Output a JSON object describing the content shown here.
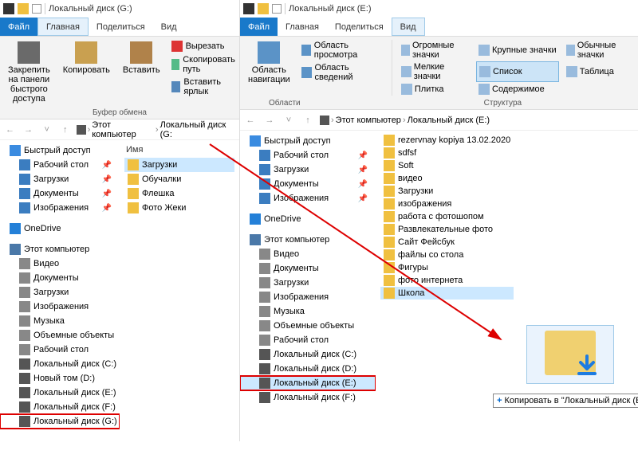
{
  "w1": {
    "title": "Локальный диск (G:)",
    "menu": {
      "file": "Файл",
      "home": "Главная",
      "share": "Поделиться",
      "view": "Вид"
    },
    "ribbon": {
      "pin": "Закрепить на панели быстрого доступа",
      "copy": "Копировать",
      "paste": "Вставить",
      "cut": "Вырезать",
      "copypath": "Скопировать путь",
      "shortcut": "Вставить ярлык",
      "group": "Буфер обмена"
    },
    "crumbs": {
      "pc": "Этот компьютер",
      "drive": "Локальный диск (G:"
    },
    "nav": {
      "quick": "Быстрый доступ",
      "desktop": "Рабочий стол",
      "downloads": "Загрузки",
      "documents": "Документы",
      "pictures": "Изображения",
      "onedrive": "OneDrive",
      "thispc": "Этот компьютер",
      "video": "Видео",
      "docs2": "Документы",
      "dl2": "Загрузки",
      "pics2": "Изображения",
      "music": "Музыка",
      "obj3d": "Объемные объекты",
      "desk2": "Рабочий стол",
      "diskC": "Локальный диск (C:)",
      "diskD": "Новый том (D:)",
      "diskE": "Локальный диск (E:)",
      "diskF": "Локальный диск (F:)",
      "diskG": "Локальный диск (G:)"
    },
    "colhead": "Имя",
    "files": {
      "f1": "Загрузки",
      "f2": "Обучалки",
      "f3": "Флешка",
      "f4": "Фото Жеки"
    }
  },
  "w2": {
    "title": "Локальный диск (E:)",
    "menu": {
      "file": "Файл",
      "home": "Главная",
      "share": "Поделиться",
      "view": "Вид"
    },
    "ribbon": {
      "navpane": "Область навигации",
      "preview": "Область просмотра",
      "details": "Область сведений",
      "group1": "Области",
      "huge": "Огромные значки",
      "large": "Крупные значки",
      "normal": "Обычные значки",
      "small": "Мелкие значки",
      "list": "Список",
      "table": "Таблица",
      "tiles": "Плитка",
      "content": "Содержимое",
      "group2": "Структура"
    },
    "crumbs": {
      "pc": "Этот компьютер",
      "drive": "Локальный диск (E:)"
    },
    "nav": {
      "quick": "Быстрый доступ",
      "desktop": "Рабочий стол",
      "downloads": "Загрузки",
      "documents": "Документы",
      "pictures": "Изображения",
      "onedrive": "OneDrive",
      "thispc": "Этот компьютер",
      "video": "Видео",
      "docs2": "Документы",
      "dl2": "Загрузки",
      "pics2": "Изображения",
      "music": "Музыка",
      "obj3d": "Объемные объекты",
      "desk2": "Рабочий стол",
      "diskC": "Локальный диск (C:)",
      "diskD": "Локальный диск (D:)",
      "diskE": "Локальный диск (E:)",
      "diskF": "Локальный диск (F:)"
    },
    "folders": {
      "f0": "rezervnay kopiya 13.02.2020",
      "f1": "sdfsf",
      "f2": "Soft",
      "f3": "видео",
      "f4": "Загрузки",
      "f5": "изображения",
      "f6": "работа с фотошопом",
      "f7": "Развлекательные фото",
      "f8": "Сайт Фейсбук",
      "f9": "файлы со стола",
      "f10": "Фигуры",
      "f11": "фото интернета",
      "f12": "Школа"
    },
    "copytip": "Копировать в \"Локальный диск (E:)\""
  }
}
